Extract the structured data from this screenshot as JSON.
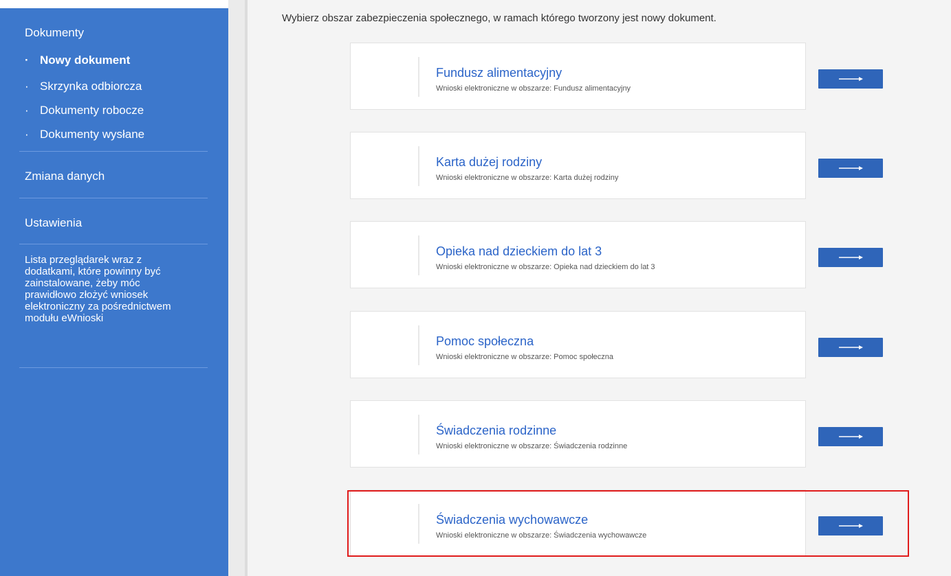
{
  "sidebar": {
    "documents_heading": "Dokumenty",
    "items": [
      {
        "label": "Nowy dokument",
        "active": true
      },
      {
        "label": "Skrzynka odbiorcza",
        "active": false
      },
      {
        "label": "Dokumenty robocze",
        "active": false
      },
      {
        "label": "Dokumenty wysłane",
        "active": false
      }
    ],
    "bullet": "·",
    "change_data": "Zmiana danych",
    "settings": "Ustawienia",
    "browser_note": [
      "Lista przeglądarek wraz z",
      "dodatkami, które powinny być",
      "zainstalowane, żeby móc",
      "prawidłowo złożyć wniosek",
      "elektroniczny za pośrednictwem",
      "modułu eWnioski"
    ],
    "background_color": "#3d78cc"
  },
  "main": {
    "instruction": "Wybierz obszar zabezpieczenia społecznego, w ramach którego tworzony jest nowy dokument.",
    "cards": [
      {
        "title": "Fundusz alimentacyjny",
        "subtitle": "Wnioski elektroniczne w obszarze: Fundusz alimentacyjny",
        "highlighted": false
      },
      {
        "title": "Karta dużej rodziny",
        "subtitle": "Wnioski elektroniczne w obszarze: Karta dużej rodziny",
        "highlighted": false
      },
      {
        "title": "Opieka nad dzieckiem do lat 3",
        "subtitle": "Wnioski elektroniczne w obszarze: Opieka nad dzieckiem do lat 3",
        "highlighted": false
      },
      {
        "title": "Pomoc społeczna",
        "subtitle": "Wnioski elektroniczne w obszarze: Pomoc społeczna",
        "highlighted": false
      },
      {
        "title": "Świadczenia rodzinne",
        "subtitle": "Wnioski elektroniczne w obszarze: Świadczenia rodzinne",
        "highlighted": false
      },
      {
        "title": "Świadczenia wychowawcze",
        "subtitle": "Wnioski elektroniczne w obszarze: Świadczenia wychowawcze",
        "highlighted": true
      }
    ],
    "arrow_icon": "arrow-right-icon",
    "title_color": "#2b64c8",
    "button_color": "#2f65b9",
    "highlight_color": "#e01b1b"
  }
}
